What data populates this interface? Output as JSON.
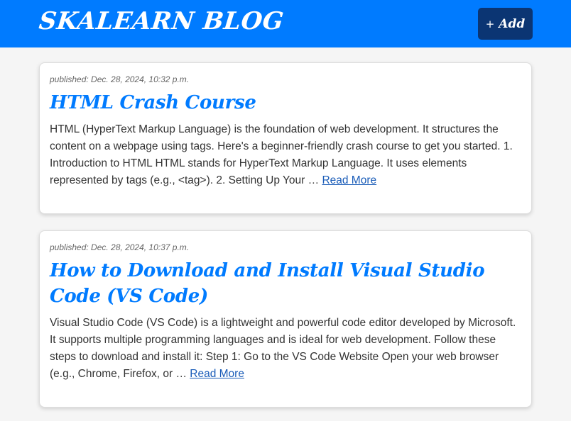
{
  "header": {
    "brand": "SKALEARN BLOG",
    "add_button": {
      "icon": "+",
      "label": "Add"
    }
  },
  "posts": [
    {
      "published": "published: Dec. 28, 2024, 10:32 p.m.",
      "title": "HTML Crash Course",
      "excerpt": "HTML (HyperText Markup Language) is the foundation of web development. It structures the content on a webpage using tags. Here's a beginner-friendly crash course to get you started. 1. Introduction to HTML HTML stands for HyperText Markup Language. It uses elements represented by tags (e.g., <tag>). 2. Setting Up Your …",
      "read_more": "Read More"
    },
    {
      "published": "published: Dec. 28, 2024, 10:37 p.m.",
      "title": "How to Download and Install Visual Studio Code (VS Code)",
      "excerpt": "Visual Studio Code (VS Code) is a lightweight and powerful code editor developed by Microsoft. It supports multiple programming languages and is ideal for web development. Follow these steps to download and install it: Step 1: Go to the VS Code Website Open your web browser (e.g., Chrome, Firefox, or …",
      "read_more": "Read More"
    }
  ],
  "colors": {
    "header_bg": "#007bff",
    "add_button_bg": "#0b3573",
    "title": "#007bff",
    "link": "#1a5cb8",
    "page_bg": "#f5f5f5"
  }
}
